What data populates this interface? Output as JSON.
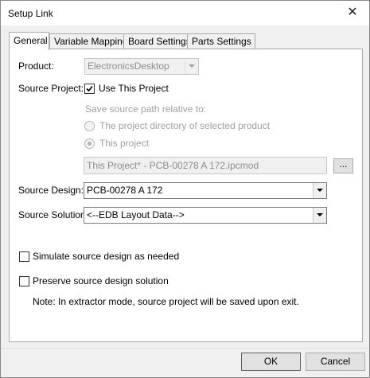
{
  "window": {
    "title": "Setup Link",
    "close_glyph": "✕"
  },
  "tabs": [
    {
      "label": "General",
      "active": true
    },
    {
      "label": "Variable Mapping",
      "active": false
    },
    {
      "label": "Board Settings",
      "active": false
    },
    {
      "label": "Parts Settings",
      "active": false
    }
  ],
  "general": {
    "product_label": "Product:",
    "product_value": "ElectronicsDesktop",
    "source_project_label": "Source Project:",
    "use_this_project_label": "Use This Project",
    "use_this_project_checked": true,
    "save_relative_label": "Save source path relative to:",
    "radio_project_dir_label": "The project directory of selected product",
    "radio_project_dir_selected": false,
    "radio_this_project_label": "This project",
    "radio_this_project_selected": true,
    "project_path_value": "This Project* - PCB-00278 A 172.ipcmod",
    "browse_label": "...",
    "source_design_label": "Source Design:",
    "source_design_value": "PCB-00278 A 172",
    "source_solution_label": "Source Solution:",
    "source_solution_value": "<--EDB Layout Data-->",
    "simulate_label": "Simulate source design as needed",
    "simulate_checked": false,
    "preserve_label": "Preserve source design solution",
    "preserve_checked": false,
    "note": "Note: In extractor mode, source project will be saved upon exit."
  },
  "footer": {
    "ok_label": "OK",
    "cancel_label": "Cancel"
  }
}
